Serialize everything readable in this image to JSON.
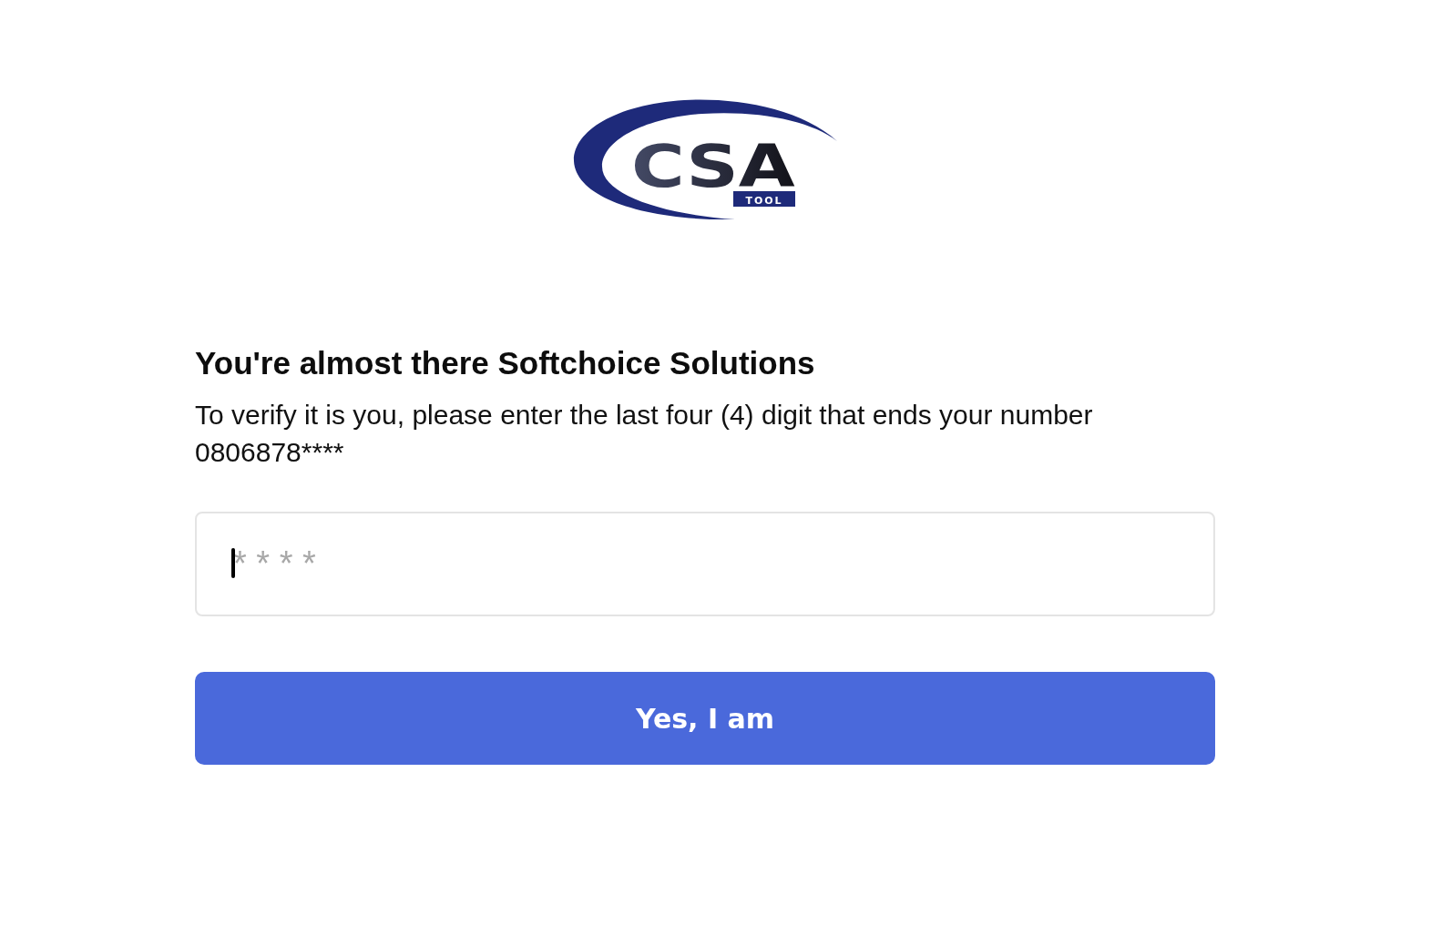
{
  "logo": {
    "wordmark": "CSA",
    "badge": "TOOL"
  },
  "heading": "You're almost there Softchoice Solutions",
  "instructions": "To verify it is you, please enter the last four (4) digit that ends your number 0806878****",
  "code_field": {
    "placeholder": "* * * *",
    "focused": true
  },
  "submit_button": {
    "label": "Yes, I am"
  }
}
